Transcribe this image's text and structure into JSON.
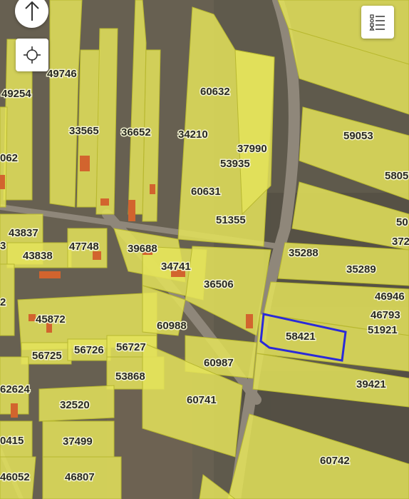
{
  "map": {
    "parcels": [
      {
        "id": "49746"
      },
      {
        "id": "49254"
      },
      {
        "id": "60632"
      },
      {
        "id": "33565"
      },
      {
        "id": "36652"
      },
      {
        "id": "34210"
      },
      {
        "id": "37990"
      },
      {
        "id": "59053"
      },
      {
        "id": "062"
      },
      {
        "id": "53935"
      },
      {
        "id": "5805"
      },
      {
        "id": "60631"
      },
      {
        "id": "50"
      },
      {
        "id": "51355"
      },
      {
        "id": "43837"
      },
      {
        "id": "372"
      },
      {
        "id": "3"
      },
      {
        "id": "47748"
      },
      {
        "id": "39688"
      },
      {
        "id": "35288"
      },
      {
        "id": "43838"
      },
      {
        "id": "34741"
      },
      {
        "id": "35289"
      },
      {
        "id": "36506"
      },
      {
        "id": "2"
      },
      {
        "id": "46946"
      },
      {
        "id": "45872"
      },
      {
        "id": "46793"
      },
      {
        "id": "60988"
      },
      {
        "id": "58421"
      },
      {
        "id": "51921"
      },
      {
        "id": "56725"
      },
      {
        "id": "56726"
      },
      {
        "id": "56727"
      },
      {
        "id": "60987"
      },
      {
        "id": "53868"
      },
      {
        "id": "39421"
      },
      {
        "id": "62624"
      },
      {
        "id": "60741"
      },
      {
        "id": "32520"
      },
      {
        "id": "0415"
      },
      {
        "id": "37499"
      },
      {
        "id": "60742"
      },
      {
        "id": "46052"
      },
      {
        "id": "46807"
      }
    ],
    "selected_parcel": "58421",
    "colors": {
      "parcel_fill": "#e4e35a",
      "parcel_outline": "#b8b830",
      "selection_outline": "#2a2ad8",
      "imagery_dark": "#5f5a4c",
      "road": "#8f877a"
    }
  },
  "controls": {
    "north": {
      "icon": "arrow-up-icon"
    },
    "locate": {
      "icon": "crosshair-icon"
    },
    "layers": {
      "icon": "legend-list-icon"
    }
  }
}
